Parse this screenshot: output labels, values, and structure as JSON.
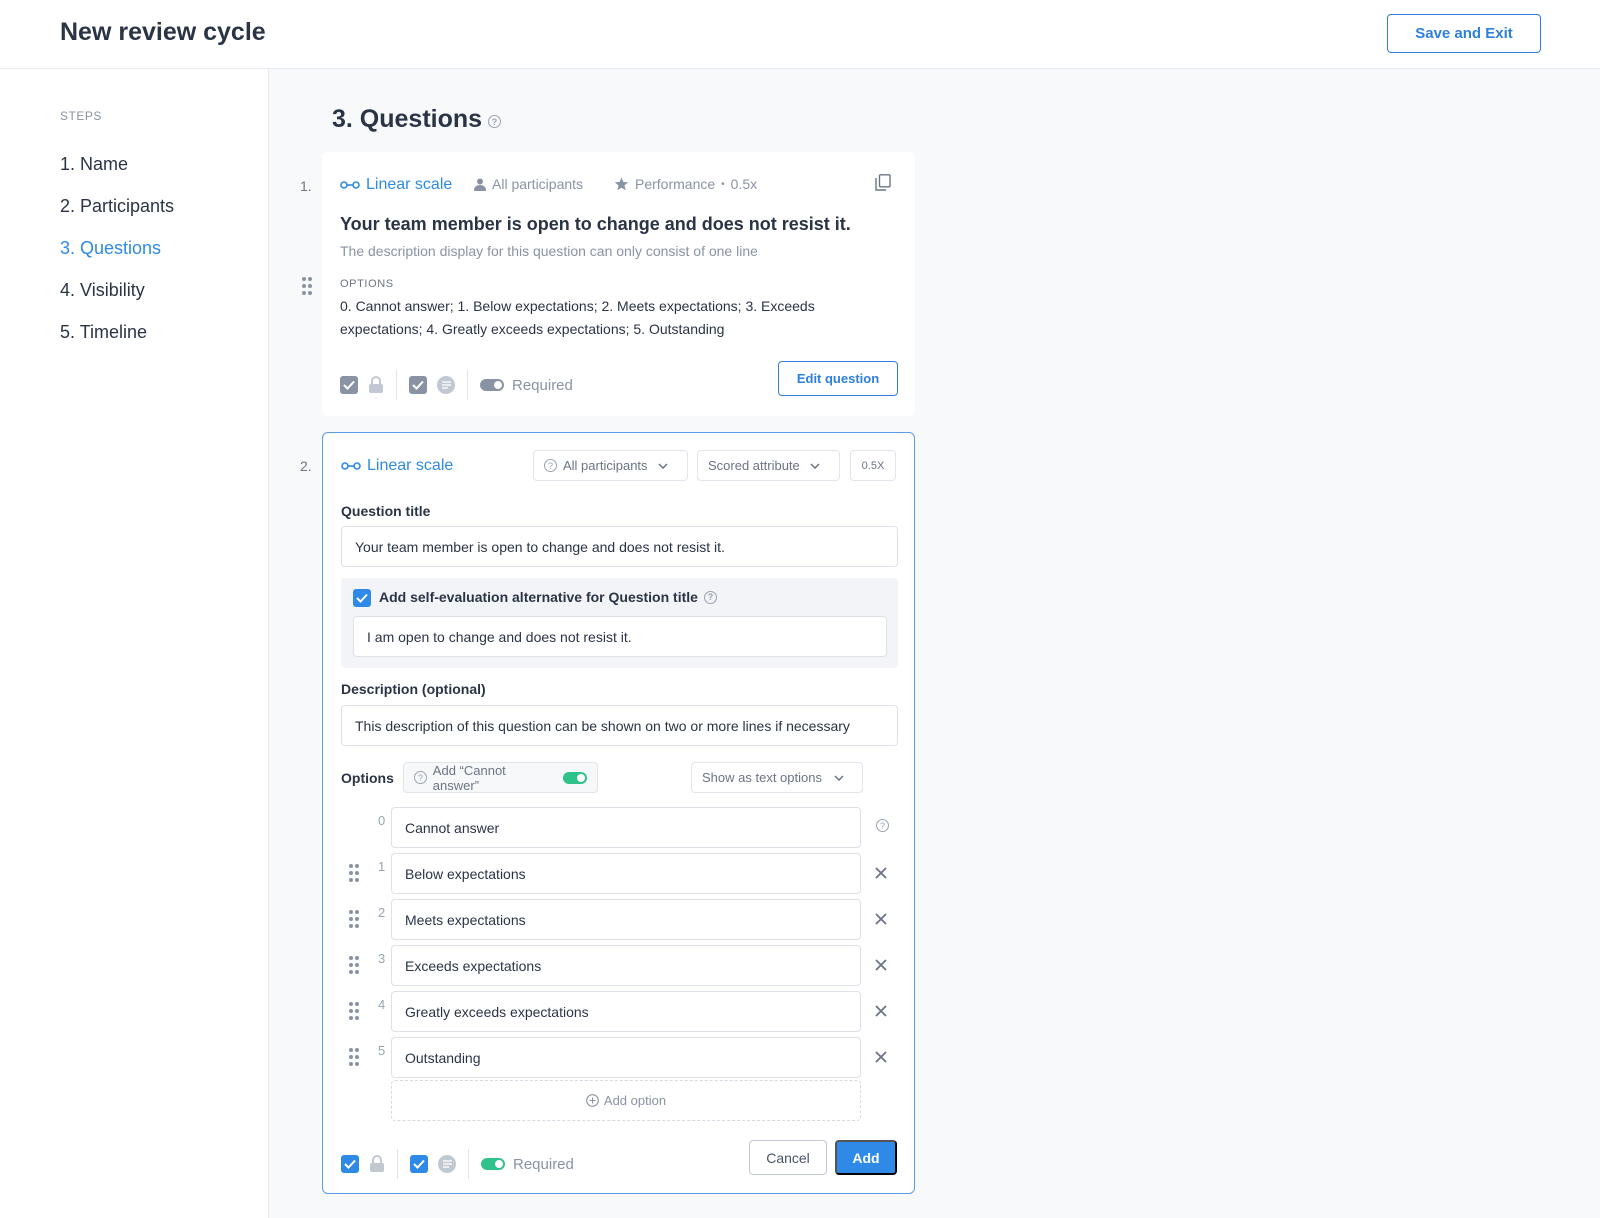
{
  "header": {
    "title": "New review cycle",
    "save_exit": "Save and Exit"
  },
  "sidebar": {
    "label": "STEPS",
    "steps": [
      "1. Name",
      "2. Participants",
      "3. Questions",
      "4. Visibility",
      "5. Timeline"
    ],
    "active_index": 2
  },
  "section": {
    "title": "3. Questions"
  },
  "question1": {
    "number": "1.",
    "type": "Linear scale",
    "participants": "All participants",
    "category": "Performance",
    "weight": "0.5x",
    "title": "Your team member is open to change and does not resist it.",
    "description": "The description display for this question can only consist of one line",
    "options_label": "OPTIONS",
    "options_text": "0. Cannot answer; 1. Below expectations; 2. Meets expectations; 3. Exceeds expectations; 4. Greatly exceeds expectations; 5. Outstanding",
    "required_label": "Required",
    "edit_button": "Edit question"
  },
  "question2": {
    "number": "2.",
    "type": "Linear scale",
    "participants_select": "All participants",
    "attribute_select": "Scored attribute",
    "weight": "0.5X",
    "title_label": "Question title",
    "title_value": "Your team member is open to change and does not resist it.",
    "self_eval_label": "Add self-evaluation alternative for Question title",
    "self_eval_value": "I am open to change and does not resist it.",
    "description_label": "Description (optional)",
    "description_value": "This description of this question can be shown on two or more lines if necessary",
    "options_label": "Options",
    "cannot_answer_toggle": "Add “Cannot answer”",
    "display_select": "Show as text options",
    "options": [
      {
        "index": "0",
        "value": "Cannot answer"
      },
      {
        "index": "1",
        "value": "Below expectations"
      },
      {
        "index": "2",
        "value": "Meets expectations"
      },
      {
        "index": "3",
        "value": "Exceeds expectations"
      },
      {
        "index": "4",
        "value": "Greatly exceeds expectations"
      },
      {
        "index": "5",
        "value": "Outstanding"
      }
    ],
    "add_option": "Add option",
    "required_label": "Required",
    "cancel": "Cancel",
    "add": "Add"
  },
  "colors": {
    "accent": "#2e8ae6",
    "toggle_on": "#2fc28a",
    "text": "#2b3445"
  }
}
